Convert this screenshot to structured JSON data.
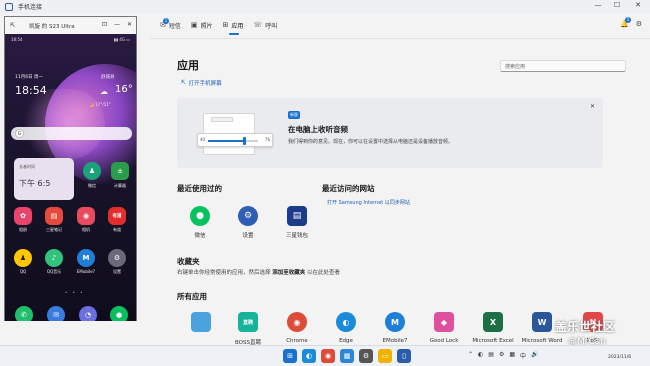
{
  "window": {
    "title": "手机连接",
    "minimize": "—",
    "maximize": "☐",
    "close": "✕"
  },
  "tabs": [
    {
      "label": "短信",
      "icon": "✉",
      "badge": "1"
    },
    {
      "label": "照片",
      "icon": "▣"
    },
    {
      "label": "应用",
      "icon": "⊞"
    },
    {
      "label": "呼叫",
      "icon": "☏"
    }
  ],
  "top_right": {
    "notif_badge": "5",
    "bell": "🔔",
    "settings": "⚙"
  },
  "page": {
    "title": "应用",
    "open_screen": "打开手机屏幕",
    "search_placeholder": "搜索应用"
  },
  "banner": {
    "tag": "新版",
    "title": "在电脑上收听音频",
    "text": "我们得到你的意见。现在，你可以在设置中选择从电脑还是设备播放音频。",
    "slider_lo": "40",
    "slider_hi": "76",
    "slider_value": 0.72,
    "close": "✕"
  },
  "recent": {
    "title": "最近使用过的",
    "apps": [
      {
        "label": "微信",
        "icon": "●",
        "color": "#07c160"
      },
      {
        "label": "设置",
        "icon": "⚙",
        "color": "#2e5fb4"
      },
      {
        "label": "三星钱包",
        "icon": "▤",
        "color": "#1d3b8b"
      }
    ]
  },
  "websites": {
    "title": "最近访问的网站",
    "link": "打开 Samsung Internet 以同步网站"
  },
  "favorites": {
    "title": "收藏夹",
    "text_before": "右键单击你经常使用的应用，然后选择 ",
    "action": "添加至收藏夹",
    "text_after": " 以在此处查看"
  },
  "all_apps": {
    "title": "所有应用",
    "apps": [
      {
        "label": "",
        "icon": "",
        "color": "#4aa3df"
      },
      {
        "label": "BOSS直聘",
        "icon": "直聘",
        "color": "#17b29a"
      },
      {
        "label": "Chrome",
        "icon": "◉",
        "color": "#dd4b39"
      },
      {
        "label": "Edge",
        "icon": "◐",
        "color": "#1a8bd8"
      },
      {
        "label": "EMobile7",
        "icon": "M",
        "color": "#1e7fd8"
      },
      {
        "label": "Good Lock",
        "icon": "◆",
        "color": "#e0509f"
      },
      {
        "label": "Microsoft Excel",
        "icon": "X",
        "color": "#1d7044"
      },
      {
        "label": "Microsoft Word",
        "icon": "W",
        "color": "#2b579a"
      },
      {
        "label": "NoSt",
        "icon": "N",
        "color": "#e04848"
      }
    ]
  },
  "watermark": {
    "line1": "盖乐世社区",
    "line2": "@MrCan"
  },
  "phone": {
    "window_title": "凯旋 的 S23 Ultra",
    "status_time": "18:54",
    "status_right": "▮▮ 4G ▭",
    "date": "11月6日 周一",
    "clock": "18:54",
    "weather_top": "舒城县",
    "temp": "16°",
    "weather_sub": "🌙 17°/11°",
    "clock_widget_l1": "长者时间",
    "clock_widget_l2": "下午 6:5",
    "widget_apps": [
      {
        "label": "微信",
        "icon": "♟",
        "color": "#1aa37a"
      },
      {
        "label": "计算器",
        "icon": "±",
        "color": "#2a9d4b"
      }
    ],
    "home_row1": [
      {
        "label": "相册",
        "icon": "✿",
        "color": "#e9446a"
      },
      {
        "label": "三星笔记",
        "icon": "▤",
        "color": "#e64a3c"
      },
      {
        "label": "相机",
        "icon": "◉",
        "color": "#e84a5f"
      },
      {
        "label": "有道",
        "icon": "有道",
        "color": "#e52d2d"
      }
    ],
    "home_row2": [
      {
        "label": "QQ",
        "icon": "♟",
        "color": "#ffc800"
      },
      {
        "label": "QQ音乐",
        "icon": "♪",
        "color": "#31c27c"
      },
      {
        "label": "EMobile7",
        "icon": "M",
        "color": "#1e7fd8"
      },
      {
        "label": "设置",
        "icon": "⚙",
        "color": "#6a6a7a"
      }
    ],
    "dock": [
      {
        "icon": "✆",
        "color": "#1fbf6b"
      },
      {
        "icon": "✉",
        "color": "#3a7be0"
      },
      {
        "icon": "◔",
        "color": "#6c6fe0"
      },
      {
        "icon": "●",
        "color": "#07c160"
      }
    ]
  },
  "taskbar": {
    "icons": [
      {
        "name": "start-icon",
        "icon": "⊞",
        "color": "#1a6fd0"
      },
      {
        "name": "edge-icon",
        "icon": "◐",
        "color": "#1a8bd8"
      },
      {
        "name": "chrome-icon",
        "icon": "◉",
        "color": "#dd4b39"
      },
      {
        "name": "store-icon",
        "icon": "▦",
        "color": "#2b88d8"
      },
      {
        "name": "settings-icon",
        "icon": "⚙",
        "color": "#555555"
      },
      {
        "name": "explorer-icon",
        "icon": "▭",
        "color": "#f0b400"
      },
      {
        "name": "phone-link-icon",
        "icon": "▯",
        "color": "#2b5dab"
      }
    ],
    "tray": [
      "⌃",
      "◐",
      "▤",
      "⚙",
      "▦",
      "中",
      "🔊"
    ],
    "time": "2023/11/6"
  }
}
